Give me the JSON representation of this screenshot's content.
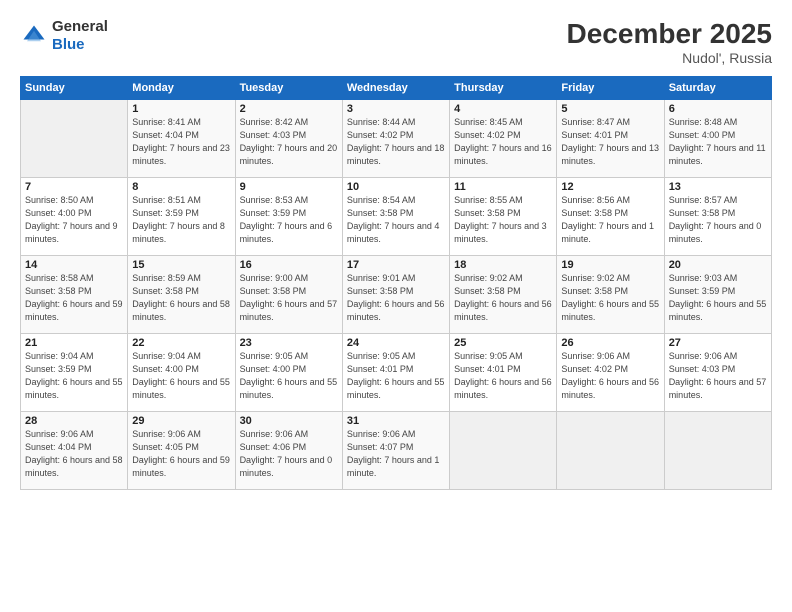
{
  "logo": {
    "general": "General",
    "blue": "Blue"
  },
  "header": {
    "month": "December 2025",
    "location": "Nudol', Russia"
  },
  "weekdays": [
    "Sunday",
    "Monday",
    "Tuesday",
    "Wednesday",
    "Thursday",
    "Friday",
    "Saturday"
  ],
  "weeks": [
    [
      {
        "day": "",
        "sunrise": "",
        "sunset": "",
        "daylight": ""
      },
      {
        "day": "1",
        "sunrise": "Sunrise: 8:41 AM",
        "sunset": "Sunset: 4:04 PM",
        "daylight": "Daylight: 7 hours and 23 minutes."
      },
      {
        "day": "2",
        "sunrise": "Sunrise: 8:42 AM",
        "sunset": "Sunset: 4:03 PM",
        "daylight": "Daylight: 7 hours and 20 minutes."
      },
      {
        "day": "3",
        "sunrise": "Sunrise: 8:44 AM",
        "sunset": "Sunset: 4:02 PM",
        "daylight": "Daylight: 7 hours and 18 minutes."
      },
      {
        "day": "4",
        "sunrise": "Sunrise: 8:45 AM",
        "sunset": "Sunset: 4:02 PM",
        "daylight": "Daylight: 7 hours and 16 minutes."
      },
      {
        "day": "5",
        "sunrise": "Sunrise: 8:47 AM",
        "sunset": "Sunset: 4:01 PM",
        "daylight": "Daylight: 7 hours and 13 minutes."
      },
      {
        "day": "6",
        "sunrise": "Sunrise: 8:48 AM",
        "sunset": "Sunset: 4:00 PM",
        "daylight": "Daylight: 7 hours and 11 minutes."
      }
    ],
    [
      {
        "day": "7",
        "sunrise": "Sunrise: 8:50 AM",
        "sunset": "Sunset: 4:00 PM",
        "daylight": "Daylight: 7 hours and 9 minutes."
      },
      {
        "day": "8",
        "sunrise": "Sunrise: 8:51 AM",
        "sunset": "Sunset: 3:59 PM",
        "daylight": "Daylight: 7 hours and 8 minutes."
      },
      {
        "day": "9",
        "sunrise": "Sunrise: 8:53 AM",
        "sunset": "Sunset: 3:59 PM",
        "daylight": "Daylight: 7 hours and 6 minutes."
      },
      {
        "day": "10",
        "sunrise": "Sunrise: 8:54 AM",
        "sunset": "Sunset: 3:58 PM",
        "daylight": "Daylight: 7 hours and 4 minutes."
      },
      {
        "day": "11",
        "sunrise": "Sunrise: 8:55 AM",
        "sunset": "Sunset: 3:58 PM",
        "daylight": "Daylight: 7 hours and 3 minutes."
      },
      {
        "day": "12",
        "sunrise": "Sunrise: 8:56 AM",
        "sunset": "Sunset: 3:58 PM",
        "daylight": "Daylight: 7 hours and 1 minute."
      },
      {
        "day": "13",
        "sunrise": "Sunrise: 8:57 AM",
        "sunset": "Sunset: 3:58 PM",
        "daylight": "Daylight: 7 hours and 0 minutes."
      }
    ],
    [
      {
        "day": "14",
        "sunrise": "Sunrise: 8:58 AM",
        "sunset": "Sunset: 3:58 PM",
        "daylight": "Daylight: 6 hours and 59 minutes."
      },
      {
        "day": "15",
        "sunrise": "Sunrise: 8:59 AM",
        "sunset": "Sunset: 3:58 PM",
        "daylight": "Daylight: 6 hours and 58 minutes."
      },
      {
        "day": "16",
        "sunrise": "Sunrise: 9:00 AM",
        "sunset": "Sunset: 3:58 PM",
        "daylight": "Daylight: 6 hours and 57 minutes."
      },
      {
        "day": "17",
        "sunrise": "Sunrise: 9:01 AM",
        "sunset": "Sunset: 3:58 PM",
        "daylight": "Daylight: 6 hours and 56 minutes."
      },
      {
        "day": "18",
        "sunrise": "Sunrise: 9:02 AM",
        "sunset": "Sunset: 3:58 PM",
        "daylight": "Daylight: 6 hours and 56 minutes."
      },
      {
        "day": "19",
        "sunrise": "Sunrise: 9:02 AM",
        "sunset": "Sunset: 3:58 PM",
        "daylight": "Daylight: 6 hours and 55 minutes."
      },
      {
        "day": "20",
        "sunrise": "Sunrise: 9:03 AM",
        "sunset": "Sunset: 3:59 PM",
        "daylight": "Daylight: 6 hours and 55 minutes."
      }
    ],
    [
      {
        "day": "21",
        "sunrise": "Sunrise: 9:04 AM",
        "sunset": "Sunset: 3:59 PM",
        "daylight": "Daylight: 6 hours and 55 minutes."
      },
      {
        "day": "22",
        "sunrise": "Sunrise: 9:04 AM",
        "sunset": "Sunset: 4:00 PM",
        "daylight": "Daylight: 6 hours and 55 minutes."
      },
      {
        "day": "23",
        "sunrise": "Sunrise: 9:05 AM",
        "sunset": "Sunset: 4:00 PM",
        "daylight": "Daylight: 6 hours and 55 minutes."
      },
      {
        "day": "24",
        "sunrise": "Sunrise: 9:05 AM",
        "sunset": "Sunset: 4:01 PM",
        "daylight": "Daylight: 6 hours and 55 minutes."
      },
      {
        "day": "25",
        "sunrise": "Sunrise: 9:05 AM",
        "sunset": "Sunset: 4:01 PM",
        "daylight": "Daylight: 6 hours and 56 minutes."
      },
      {
        "day": "26",
        "sunrise": "Sunrise: 9:06 AM",
        "sunset": "Sunset: 4:02 PM",
        "daylight": "Daylight: 6 hours and 56 minutes."
      },
      {
        "day": "27",
        "sunrise": "Sunrise: 9:06 AM",
        "sunset": "Sunset: 4:03 PM",
        "daylight": "Daylight: 6 hours and 57 minutes."
      }
    ],
    [
      {
        "day": "28",
        "sunrise": "Sunrise: 9:06 AM",
        "sunset": "Sunset: 4:04 PM",
        "daylight": "Daylight: 6 hours and 58 minutes."
      },
      {
        "day": "29",
        "sunrise": "Sunrise: 9:06 AM",
        "sunset": "Sunset: 4:05 PM",
        "daylight": "Daylight: 6 hours and 59 minutes."
      },
      {
        "day": "30",
        "sunrise": "Sunrise: 9:06 AM",
        "sunset": "Sunset: 4:06 PM",
        "daylight": "Daylight: 7 hours and 0 minutes."
      },
      {
        "day": "31",
        "sunrise": "Sunrise: 9:06 AM",
        "sunset": "Sunset: 4:07 PM",
        "daylight": "Daylight: 7 hours and 1 minute."
      },
      {
        "day": "",
        "sunrise": "",
        "sunset": "",
        "daylight": ""
      },
      {
        "day": "",
        "sunrise": "",
        "sunset": "",
        "daylight": ""
      },
      {
        "day": "",
        "sunrise": "",
        "sunset": "",
        "daylight": ""
      }
    ]
  ]
}
